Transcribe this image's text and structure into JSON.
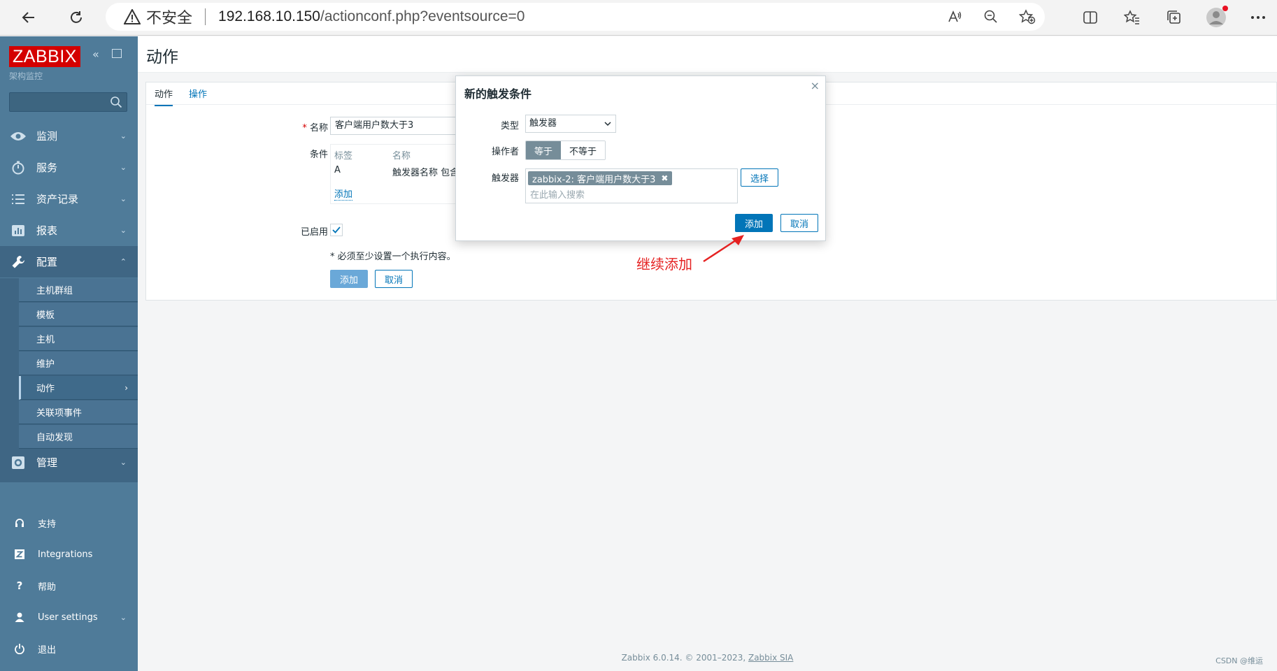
{
  "browser": {
    "security_label": "不安全",
    "url_host": "192.168.10.150",
    "url_path": "/actionconf.php?eventsource=0"
  },
  "sidebar": {
    "logo": "ZABBIX",
    "subtitle": "架构监控",
    "menu": [
      {
        "label": "监测",
        "icon": "eye-icon"
      },
      {
        "label": "服务",
        "icon": "stopwatch-icon"
      },
      {
        "label": "资产记录",
        "icon": "list-icon"
      },
      {
        "label": "报表",
        "icon": "bar-chart-icon"
      },
      {
        "label": "配置",
        "icon": "wrench-icon"
      },
      {
        "label": "管理",
        "icon": "gear-icon"
      }
    ],
    "config_submenu": [
      "主机群组",
      "模板",
      "主机",
      "维护",
      "动作",
      "关联项事件",
      "自动发现"
    ],
    "bottom": [
      {
        "label": "支持",
        "icon": "headset-icon"
      },
      {
        "label": "Integrations",
        "icon": "z-icon"
      },
      {
        "label": "帮助",
        "icon": "question-icon"
      },
      {
        "label": "User settings",
        "icon": "user-icon"
      },
      {
        "label": "退出",
        "icon": "power-icon"
      }
    ]
  },
  "page": {
    "title": "动作",
    "tabs": [
      "动作",
      "操作"
    ],
    "form": {
      "name_label": "名称",
      "name_value": "客户端用户数大于3",
      "conditions_label": "条件",
      "cond_header_label": "标签",
      "cond_header_name": "名称",
      "cond_row_label": "A",
      "cond_row_name": "触发器名称 包含",
      "cond_add_link": "添加",
      "enabled_label": "已启用",
      "required_note": "* 必须至少设置一个执行内容。",
      "add_button": "添加",
      "cancel_button": "取消"
    }
  },
  "dialog": {
    "title": "新的触发条件",
    "type_label": "类型",
    "type_value": "触发器",
    "operator_label": "操作者",
    "operator_options": [
      "等于",
      "不等于"
    ],
    "operator_selected": "等于",
    "trigger_label": "触发器",
    "trigger_tag": "zabbix-2: 客户端用户数大于3",
    "search_placeholder": "在此输入搜索",
    "select_button": "选择",
    "add_button": "添加",
    "cancel_button": "取消"
  },
  "annotation": "继续添加",
  "footer": {
    "text": "Zabbix 6.0.14. © 2001–2023, ",
    "link": "Zabbix SIA"
  },
  "watermark": "CSDN @维运",
  "colors": {
    "sidebar": "#4f7b99",
    "accent": "#0275b8",
    "logo": "#d40000",
    "annotation": "#e52222"
  }
}
